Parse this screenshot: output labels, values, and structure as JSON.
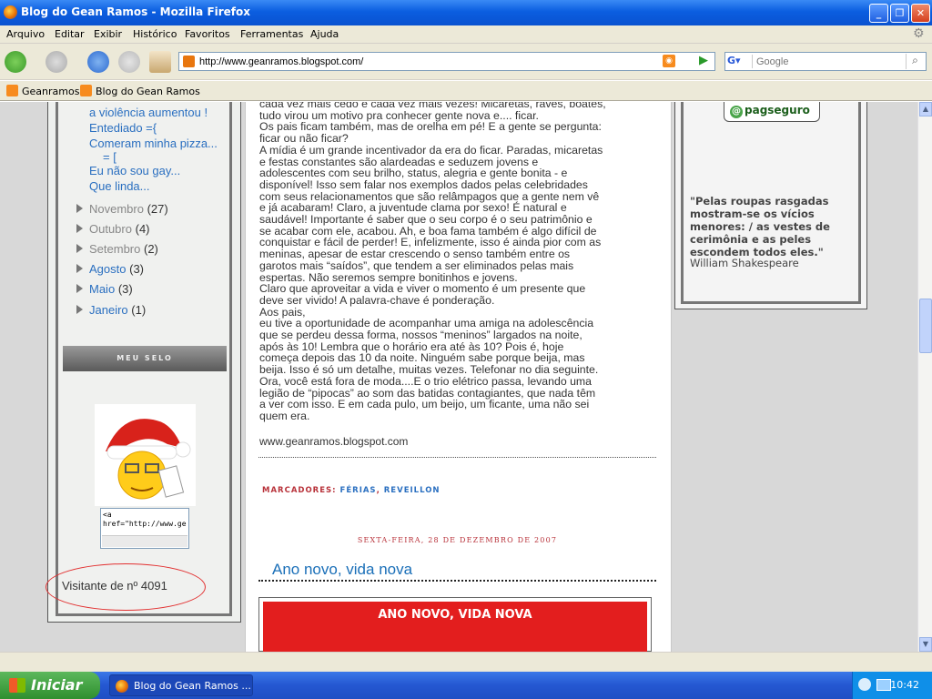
{
  "window": {
    "title": "Blog do Gean Ramos - Mozilla Firefox"
  },
  "menu": [
    "Arquivo",
    "Editar",
    "Exibir",
    "Histórico",
    "Favoritos",
    "Ferramentas",
    "Ajuda"
  ],
  "nav": {
    "url": "http://www.geanramos.blogspot.com/",
    "search_placeholder": "Google"
  },
  "bookmarks": [
    "Geanramos",
    "Blog do Gean Ramos"
  ],
  "sidebar": {
    "post_links": [
      "a violência aumentou !",
      "Entediado ={",
      "Comeram minha pizza...",
      "= [",
      "Eu não sou gay...",
      "Que linda..."
    ],
    "archive": [
      {
        "month": "Novembro",
        "count": "(27)"
      },
      {
        "month": "Outubro",
        "count": "(4)"
      },
      {
        "month": "Setembro",
        "count": "(2)"
      },
      {
        "month": "Agosto",
        "count": "(3)"
      },
      {
        "month": "Maio",
        "count": "(3)"
      },
      {
        "month": "Janeiro",
        "count": "(1)"
      }
    ],
    "selo_header": "MEU SELO",
    "code_line1": "<a",
    "code_line2": "href=\"http://www.ge",
    "visitors": "Visitante de nº 4091"
  },
  "post": {
    "lines": [
      "cada vez mais cedo e cada vez mais vezes! Micaretas, raves, boates,",
      "tudo virou um motivo pra conhecer gente nova e.... ficar.",
      "Os pais ficam também, mas de orelha em pé! E a gente se pergunta:",
      "ficar ou não ficar?",
      "A mídia é um grande incentivador da era do ficar. Paradas, micaretas",
      "e festas constantes são alardeadas e seduzem jovens e",
      "adolescentes com seu brilho, status, alegria e gente bonita - e",
      "disponível! Isso sem falar nos exemplos dados pelas celebridades",
      "com seus relacionamentos que são relâmpagos que a gente nem vê",
      "e já acabaram! Claro, a juventude clama por sexo! É natural e",
      "saudável! Importante é saber que o seu corpo é o seu patrimônio e",
      "se acabar com ele, acabou. Ah, e boa fama também é algo difícil de",
      "conquistar e fácil de perder! E, infelizmente, isso é ainda pior com as",
      "meninas, apesar de estar crescendo o senso também entre os",
      "garotos mais “saídos”, que tendem a ser eliminados pelas mais",
      "espertas. Não seremos sempre bonitinhos e jovens.",
      "Claro que aproveitar a vida e viver o momento é um presente que",
      "deve ser vivido! A palavra-chave é ponderação.",
      "Aos pais,",
      "eu tive a oportunidade de acompanhar uma amiga na adolescência",
      "que se perdeu dessa forma, nossos “meninos” largados na noite,",
      "após às 10! Lembra que o horário era até às 10? Pois é, hoje",
      "começa depois das 10 da noite. Ninguém sabe porque beija, mas",
      "beija. Isso é só um detalhe, muitas vezes. Telefonar no dia seguinte.",
      "Ora, você está fora de moda....E o trio elétrico passa, levando uma",
      "legião de “pipocas” ao som das batidas contagiantes, que nada têm",
      "a ver com isso. E em cada pulo, um beijo, um ficante, uma não sei",
      "quem era."
    ],
    "site_url": "www.geanramos.blogspot.com",
    "labels_prefix": "MARCADORES:",
    "labels": [
      "FÉRIAS",
      "REVEILLON"
    ],
    "next_date": "SEXTA-FEIRA, 28 DE DEZEMBRO DE 2007",
    "next_title": "Ano novo, vida nova",
    "next_image_text": "ANO NOVO, VIDA NOVA"
  },
  "rightbar": {
    "pagseguro": "pagseguro",
    "quote": "\"Pelas roupas rasgadas mostram-se os vícios menores: / as vestes de cerimônia e as peles escondem todos eles.\"",
    "author": "William Shakespeare"
  },
  "taskbar": {
    "start": "Iniciar",
    "task": "Blog do Gean Ramos ...",
    "clock": "10:42"
  }
}
